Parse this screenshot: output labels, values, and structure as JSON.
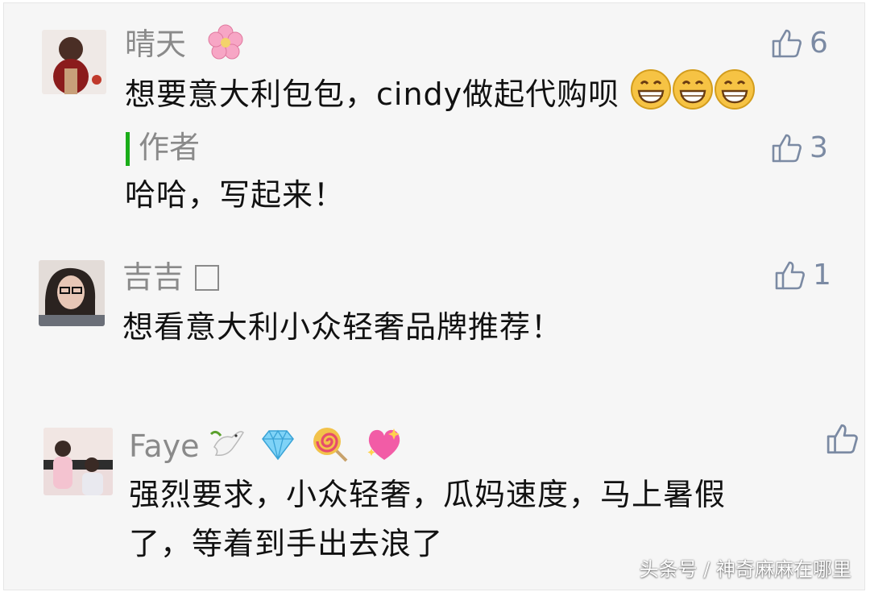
{
  "comments": [
    {
      "name": "晴天",
      "text": "想要意大利包包，cindy做起代购呗",
      "likes": "6",
      "reply": {
        "label": "作者",
        "text": "哈哈，写起来！",
        "likes": "3"
      }
    },
    {
      "name": "吉吉",
      "text": "想看意大利小众轻奢品牌推荐！",
      "likes": "1"
    },
    {
      "name": "Faye",
      "text_line1": "强烈要求，小众轻奢，瓜妈速度，马上暑假",
      "text_line2": "了，等着到手出去浪了",
      "likes": ""
    }
  ],
  "watermark": "头条号 / 神奇麻麻在哪里",
  "colors": {
    "author_accent": "#1aad19",
    "like_icon": "#7b8aa3",
    "name_text": "#8a8a8a"
  },
  "icons": [
    "thumbs-up-icon",
    "cherry-blossom-emoji",
    "grin-emoji",
    "dove-emoji",
    "gem-emoji",
    "lollipop-emoji",
    "sparkling-heart-emoji"
  ]
}
